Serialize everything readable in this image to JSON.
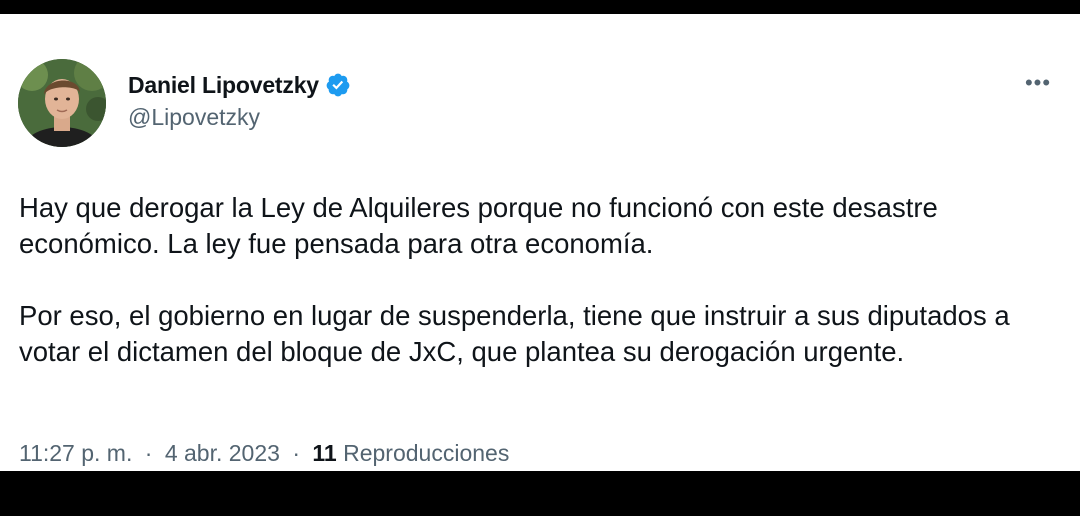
{
  "tweet": {
    "author": {
      "display_name": "Daniel Lipovetzky",
      "handle": "@Lipovetzky",
      "verified": true,
      "verified_color": "#1d9bf0"
    },
    "more_icon": "more-dots-icon",
    "body": [
      "Hay que derogar la Ley de Alquileres porque no funcionó con este desastre económico. La ley fue pensada para otra economía.",
      "Por eso, el gobierno en lugar de suspenderla, tiene que instruir a sus diputados a votar el dictamen del bloque de JxC, que plantea su derogación urgente."
    ],
    "time": "11:27 p. m.",
    "date": "4 abr. 2023",
    "separator": "·",
    "views_count": "11",
    "views_label": "Reproducciones"
  }
}
